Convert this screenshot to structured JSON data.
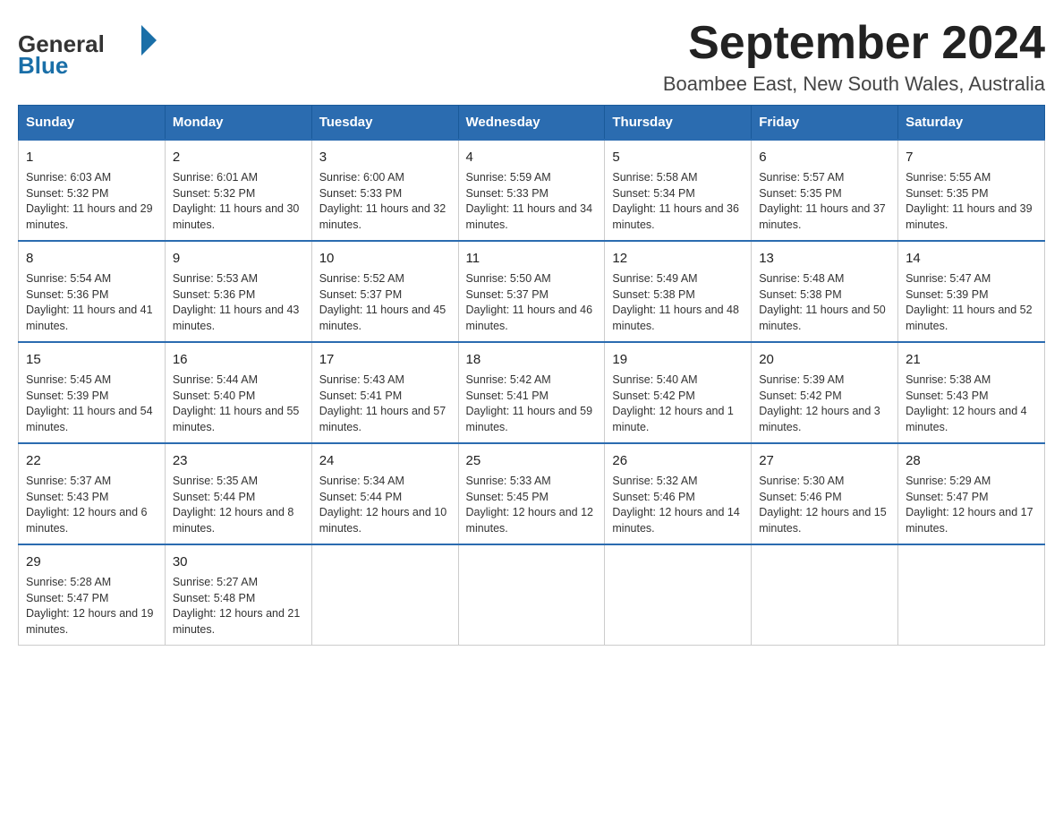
{
  "header": {
    "logo_general": "General",
    "logo_blue": "Blue",
    "month_title": "September 2024",
    "location": "Boambee East, New South Wales, Australia"
  },
  "days_of_week": [
    "Sunday",
    "Monday",
    "Tuesday",
    "Wednesday",
    "Thursday",
    "Friday",
    "Saturday"
  ],
  "weeks": [
    [
      {
        "day": "1",
        "sunrise": "Sunrise: 6:03 AM",
        "sunset": "Sunset: 5:32 PM",
        "daylight": "Daylight: 11 hours and 29 minutes."
      },
      {
        "day": "2",
        "sunrise": "Sunrise: 6:01 AM",
        "sunset": "Sunset: 5:32 PM",
        "daylight": "Daylight: 11 hours and 30 minutes."
      },
      {
        "day": "3",
        "sunrise": "Sunrise: 6:00 AM",
        "sunset": "Sunset: 5:33 PM",
        "daylight": "Daylight: 11 hours and 32 minutes."
      },
      {
        "day": "4",
        "sunrise": "Sunrise: 5:59 AM",
        "sunset": "Sunset: 5:33 PM",
        "daylight": "Daylight: 11 hours and 34 minutes."
      },
      {
        "day": "5",
        "sunrise": "Sunrise: 5:58 AM",
        "sunset": "Sunset: 5:34 PM",
        "daylight": "Daylight: 11 hours and 36 minutes."
      },
      {
        "day": "6",
        "sunrise": "Sunrise: 5:57 AM",
        "sunset": "Sunset: 5:35 PM",
        "daylight": "Daylight: 11 hours and 37 minutes."
      },
      {
        "day": "7",
        "sunrise": "Sunrise: 5:55 AM",
        "sunset": "Sunset: 5:35 PM",
        "daylight": "Daylight: 11 hours and 39 minutes."
      }
    ],
    [
      {
        "day": "8",
        "sunrise": "Sunrise: 5:54 AM",
        "sunset": "Sunset: 5:36 PM",
        "daylight": "Daylight: 11 hours and 41 minutes."
      },
      {
        "day": "9",
        "sunrise": "Sunrise: 5:53 AM",
        "sunset": "Sunset: 5:36 PM",
        "daylight": "Daylight: 11 hours and 43 minutes."
      },
      {
        "day": "10",
        "sunrise": "Sunrise: 5:52 AM",
        "sunset": "Sunset: 5:37 PM",
        "daylight": "Daylight: 11 hours and 45 minutes."
      },
      {
        "day": "11",
        "sunrise": "Sunrise: 5:50 AM",
        "sunset": "Sunset: 5:37 PM",
        "daylight": "Daylight: 11 hours and 46 minutes."
      },
      {
        "day": "12",
        "sunrise": "Sunrise: 5:49 AM",
        "sunset": "Sunset: 5:38 PM",
        "daylight": "Daylight: 11 hours and 48 minutes."
      },
      {
        "day": "13",
        "sunrise": "Sunrise: 5:48 AM",
        "sunset": "Sunset: 5:38 PM",
        "daylight": "Daylight: 11 hours and 50 minutes."
      },
      {
        "day": "14",
        "sunrise": "Sunrise: 5:47 AM",
        "sunset": "Sunset: 5:39 PM",
        "daylight": "Daylight: 11 hours and 52 minutes."
      }
    ],
    [
      {
        "day": "15",
        "sunrise": "Sunrise: 5:45 AM",
        "sunset": "Sunset: 5:39 PM",
        "daylight": "Daylight: 11 hours and 54 minutes."
      },
      {
        "day": "16",
        "sunrise": "Sunrise: 5:44 AM",
        "sunset": "Sunset: 5:40 PM",
        "daylight": "Daylight: 11 hours and 55 minutes."
      },
      {
        "day": "17",
        "sunrise": "Sunrise: 5:43 AM",
        "sunset": "Sunset: 5:41 PM",
        "daylight": "Daylight: 11 hours and 57 minutes."
      },
      {
        "day": "18",
        "sunrise": "Sunrise: 5:42 AM",
        "sunset": "Sunset: 5:41 PM",
        "daylight": "Daylight: 11 hours and 59 minutes."
      },
      {
        "day": "19",
        "sunrise": "Sunrise: 5:40 AM",
        "sunset": "Sunset: 5:42 PM",
        "daylight": "Daylight: 12 hours and 1 minute."
      },
      {
        "day": "20",
        "sunrise": "Sunrise: 5:39 AM",
        "sunset": "Sunset: 5:42 PM",
        "daylight": "Daylight: 12 hours and 3 minutes."
      },
      {
        "day": "21",
        "sunrise": "Sunrise: 5:38 AM",
        "sunset": "Sunset: 5:43 PM",
        "daylight": "Daylight: 12 hours and 4 minutes."
      }
    ],
    [
      {
        "day": "22",
        "sunrise": "Sunrise: 5:37 AM",
        "sunset": "Sunset: 5:43 PM",
        "daylight": "Daylight: 12 hours and 6 minutes."
      },
      {
        "day": "23",
        "sunrise": "Sunrise: 5:35 AM",
        "sunset": "Sunset: 5:44 PM",
        "daylight": "Daylight: 12 hours and 8 minutes."
      },
      {
        "day": "24",
        "sunrise": "Sunrise: 5:34 AM",
        "sunset": "Sunset: 5:44 PM",
        "daylight": "Daylight: 12 hours and 10 minutes."
      },
      {
        "day": "25",
        "sunrise": "Sunrise: 5:33 AM",
        "sunset": "Sunset: 5:45 PM",
        "daylight": "Daylight: 12 hours and 12 minutes."
      },
      {
        "day": "26",
        "sunrise": "Sunrise: 5:32 AM",
        "sunset": "Sunset: 5:46 PM",
        "daylight": "Daylight: 12 hours and 14 minutes."
      },
      {
        "day": "27",
        "sunrise": "Sunrise: 5:30 AM",
        "sunset": "Sunset: 5:46 PM",
        "daylight": "Daylight: 12 hours and 15 minutes."
      },
      {
        "day": "28",
        "sunrise": "Sunrise: 5:29 AM",
        "sunset": "Sunset: 5:47 PM",
        "daylight": "Daylight: 12 hours and 17 minutes."
      }
    ],
    [
      {
        "day": "29",
        "sunrise": "Sunrise: 5:28 AM",
        "sunset": "Sunset: 5:47 PM",
        "daylight": "Daylight: 12 hours and 19 minutes."
      },
      {
        "day": "30",
        "sunrise": "Sunrise: 5:27 AM",
        "sunset": "Sunset: 5:48 PM",
        "daylight": "Daylight: 12 hours and 21 minutes."
      },
      null,
      null,
      null,
      null,
      null
    ]
  ]
}
